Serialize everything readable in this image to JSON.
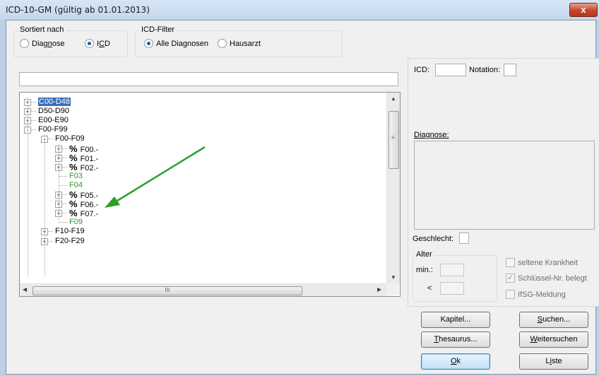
{
  "window": {
    "title": "ICD-10-GM (gültig ab 01.01.2013)",
    "close_label": "x"
  },
  "sort_group": {
    "label": "Sortiert nach",
    "options": [
      "Diagnose",
      "ICD"
    ],
    "selected": "ICD"
  },
  "filter_group": {
    "label": "ICD-Filter",
    "options": [
      "Alle Diagnosen",
      "Hausarzt"
    ],
    "selected": "Alle Diagnosen"
  },
  "search": {
    "value": ""
  },
  "tree": {
    "nodes": [
      {
        "label": "C00-D48",
        "level": 0,
        "expander": "+",
        "selected": true
      },
      {
        "label": "D50-D90",
        "level": 0,
        "expander": "+"
      },
      {
        "label": "E00-E90",
        "level": 0,
        "expander": "+"
      },
      {
        "label": "F00-F99",
        "level": 0,
        "expander": "-"
      },
      {
        "label": "F00-F09",
        "level": 1,
        "expander": "-"
      },
      {
        "label": "F00.-",
        "level": 2,
        "expander": "+",
        "pct": "%"
      },
      {
        "label": "F01.-",
        "level": 2,
        "expander": "+",
        "pct": "%"
      },
      {
        "label": "F02.-",
        "level": 2,
        "expander": "+",
        "pct": "%"
      },
      {
        "label": "F03",
        "level": 2,
        "green": true
      },
      {
        "label": "F04",
        "level": 2,
        "green": true
      },
      {
        "label": "F05.-",
        "level": 2,
        "expander": "+",
        "pct": "%"
      },
      {
        "label": "F06.-",
        "level": 2,
        "expander": "+",
        "pct": "%"
      },
      {
        "label": "F07.-",
        "level": 2,
        "expander": "+",
        "pct": "%"
      },
      {
        "label": "F09",
        "level": 2,
        "green": true
      },
      {
        "label": "F10-F19",
        "level": 1,
        "expander": "+"
      },
      {
        "label": "F20-F29",
        "level": 1,
        "expander": "+"
      }
    ],
    "hscroll_grip": "III"
  },
  "right_panel": {
    "icd_label": "ICD:",
    "notation_label": "Notation:",
    "diagnose_label": "Diagnose:",
    "geschlecht_label": "Geschlecht:",
    "alter_label": "Alter",
    "min_label": "min.:",
    "lt_label": "<",
    "checks": [
      {
        "label": "seltene Krankheit",
        "checked": false
      },
      {
        "label": "Schlüssel-Nr. belegt",
        "checked": true
      },
      {
        "label": "IfSG-Meldung",
        "checked": false
      }
    ]
  },
  "buttons": {
    "kapitel": "Kapitel...",
    "suchen": "Suchen...",
    "thesaurus": "Thesaurus...",
    "weitersuchen": "Weitersuchen",
    "ok": "Ok",
    "liste": "Liste"
  },
  "colors": {
    "green_code": "#2a9a2a",
    "selection": "#3a6fb7",
    "arrow": "#2aa02a"
  }
}
